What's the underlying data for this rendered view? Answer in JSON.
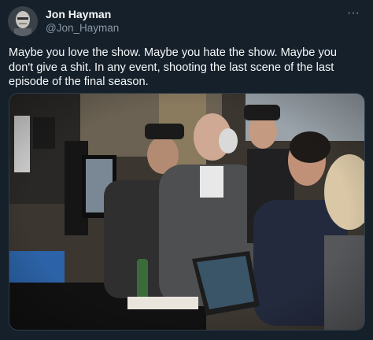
{
  "tweet": {
    "author_name": "Jon Hayman",
    "author_handle": "@Jon_Hayman",
    "more_glyph": "···",
    "text": "Maybe you love the show. Maybe you hate the show. Maybe you don't give a shit. In any event, shooting the last scene of the last episode of the final season.",
    "colors": {
      "background": "#15202b",
      "primary_text": "#f7f9f9",
      "secondary_text": "#8b98a5"
    }
  },
  "icons": {
    "more": "more-horizontal-icon"
  }
}
